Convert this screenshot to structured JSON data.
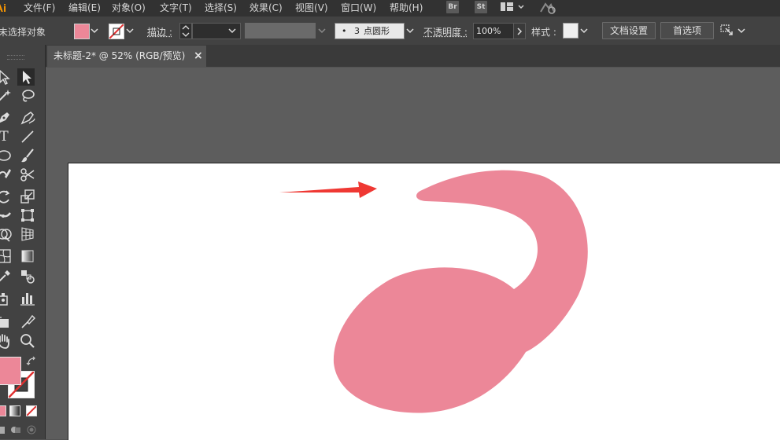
{
  "app": {
    "logo": "Ai"
  },
  "menu": [
    "文件(F)",
    "编辑(E)",
    "对象(O)",
    "文字(T)",
    "选择(S)",
    "效果(C)",
    "视图(V)",
    "窗口(W)",
    "帮助(H)"
  ],
  "menu_buttons": {
    "br": "Br",
    "st": "St"
  },
  "control": {
    "selection_status": "未选择对象",
    "stroke_label": "描边 :",
    "brush_size": "3",
    "brush_label": "点圆形",
    "brush_dot": "•",
    "opacity_label": "不透明度 :",
    "opacity_value": "100%",
    "style_label": "样式 :",
    "doc_setup": "文档设置",
    "preferences": "首选项"
  },
  "document_tab": {
    "title": "未标题-2* @ 52% (RGB/预览)",
    "close": "×"
  },
  "colors": {
    "fill": "#ec8798",
    "arrow": "#ef3833",
    "artboard": "#ffffff",
    "canvas": "#5d5d5d"
  },
  "toolbar_icons": [
    "direct-selection",
    "selection",
    "magic-wand",
    "lasso",
    "pen",
    "curvature",
    "type",
    "line-segment",
    "ellipse",
    "paintbrush",
    "shaper",
    "scissors",
    "rotate",
    "scale",
    "width",
    "free-transform",
    "shape-builder",
    "perspective-grid",
    "mesh",
    "gradient",
    "eyedropper",
    "blend",
    "symbol-sprayer",
    "column-graph",
    "artboard",
    "slice",
    "hand",
    "zoom"
  ]
}
